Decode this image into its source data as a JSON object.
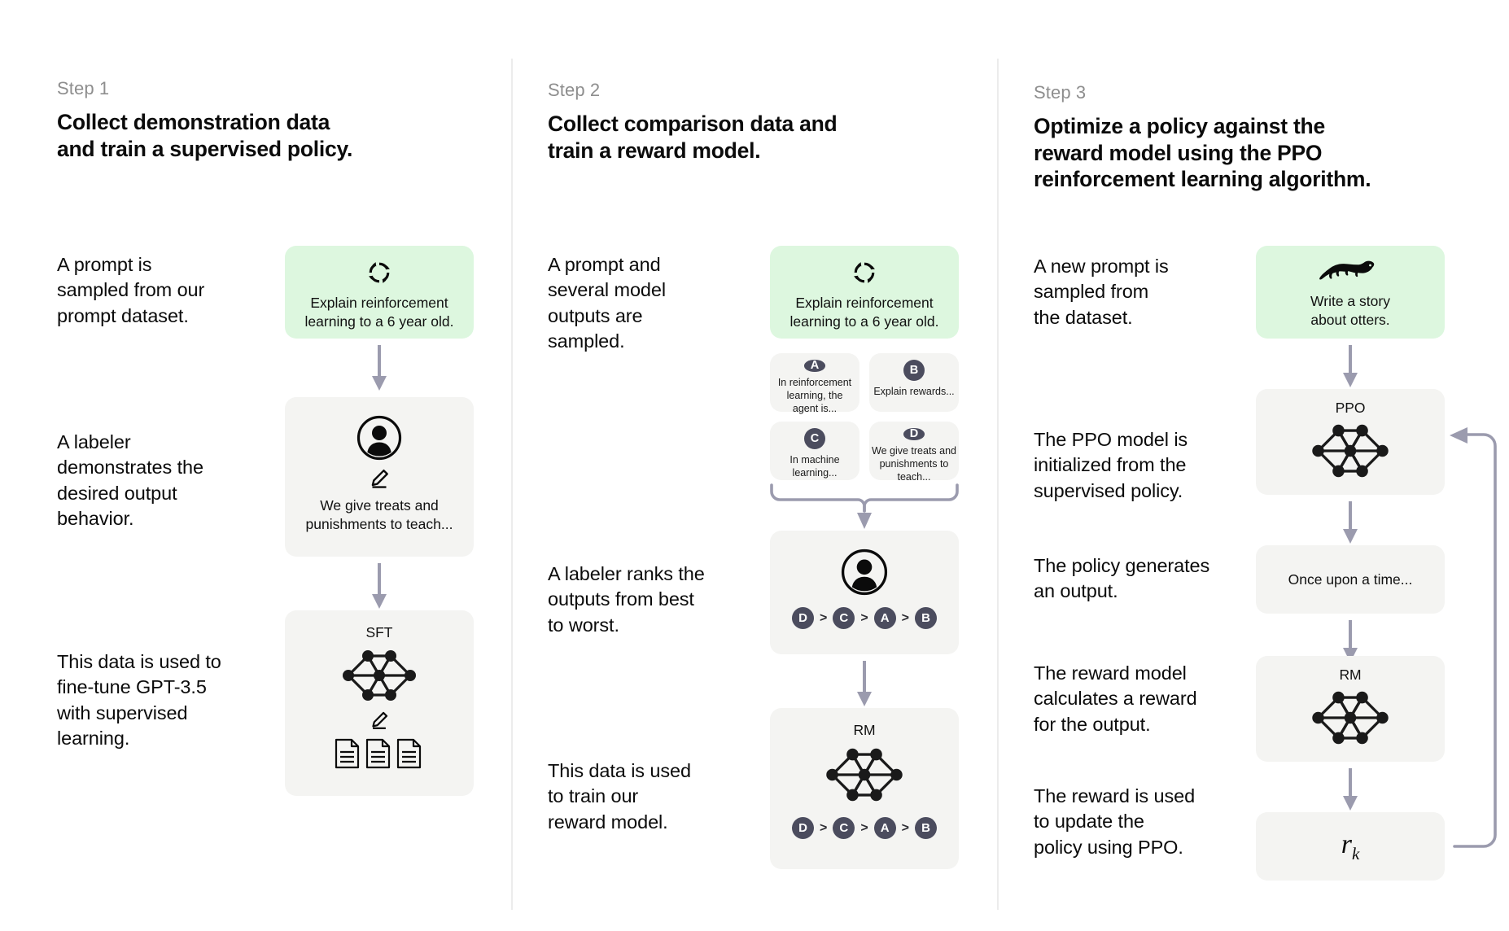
{
  "columns": [
    {
      "step_label": "Step 1",
      "title": "Collect demonstration data\nand train a supervised policy.",
      "descriptions": [
        "A prompt is\nsampled from our\nprompt dataset.",
        "A labeler\ndemonstrates the\ndesired output\nbehavior.",
        "This data is used to\nfine-tune GPT-3.5\nwith supervised\nlearning."
      ],
      "prompt_card": {
        "icon": "circular-arrows-icon",
        "text": "Explain reinforcement\nlearning to a 6 year old.",
        "bg": "#ddf7df"
      },
      "labeler_card": {
        "icon": "person-circle-icon",
        "sub_icon": "pencil-icon",
        "text": "We give treats and\npunishments to teach..."
      },
      "model_card": {
        "label": "SFT",
        "icon": "neural-network-icon",
        "sub_icon": "pencil-icon",
        "docs_icon": "documents-icon"
      }
    },
    {
      "step_label": "Step 2",
      "title": "Collect comparison data and\ntrain a reward model.",
      "descriptions": [
        "A prompt and\nseveral model\noutputs are\nsampled.",
        "A labeler ranks the\noutputs from best\nto worst.",
        "This data is used\nto train our\nreward model."
      ],
      "prompt_card": {
        "icon": "circular-arrows-icon",
        "text": "Explain reinforcement\nlearning to a 6 year old.",
        "bg": "#ddf7df"
      },
      "outputs": [
        {
          "letter": "A",
          "text": "In reinforcement\nlearning, the\nagent is..."
        },
        {
          "letter": "B",
          "text": "Explain rewards..."
        },
        {
          "letter": "C",
          "text": "In machine\nlearning..."
        },
        {
          "letter": "D",
          "text": "We give treats and\npunishments to\nteach..."
        }
      ],
      "ranking_card": {
        "icon": "person-circle-icon",
        "ranking": [
          "D",
          "C",
          "A",
          "B"
        ],
        "separator": ">"
      },
      "reward_model_card": {
        "label": "RM",
        "icon": "neural-network-icon",
        "ranking": [
          "D",
          "C",
          "A",
          "B"
        ],
        "separator": ">"
      }
    },
    {
      "step_label": "Step 3",
      "title": "Optimize a policy against the\nreward model using the PPO\nreinforcement learning algorithm.",
      "descriptions": [
        "A new prompt is\nsampled from\nthe dataset.",
        "The PPO model is\ninitialized from the\nsupervised policy.",
        "The policy generates\nan output.",
        "The reward model\ncalculates a reward\nfor the output.",
        "The reward is used\nto update the\npolicy using PPO."
      ],
      "prompt_card": {
        "icon": "otter-icon",
        "text": "Write a story\nabout otters.",
        "bg": "#ddf7df"
      },
      "ppo_card": {
        "label": "PPO",
        "icon": "neural-network-icon"
      },
      "output_card": {
        "text": "Once upon a time..."
      },
      "rm_card": {
        "label": "RM",
        "icon": "neural-network-icon"
      },
      "reward_card": {
        "symbol": "r",
        "subscript": "k"
      }
    }
  ],
  "colors": {
    "card_bg": "#f4f4f2",
    "prompt_bg": "#ddf7df",
    "arrow": "#9b9bae",
    "badge": "#4b4c5e",
    "divider": "#ececec",
    "text": "#0b0b0b",
    "step_label": "#8e8e8e"
  }
}
